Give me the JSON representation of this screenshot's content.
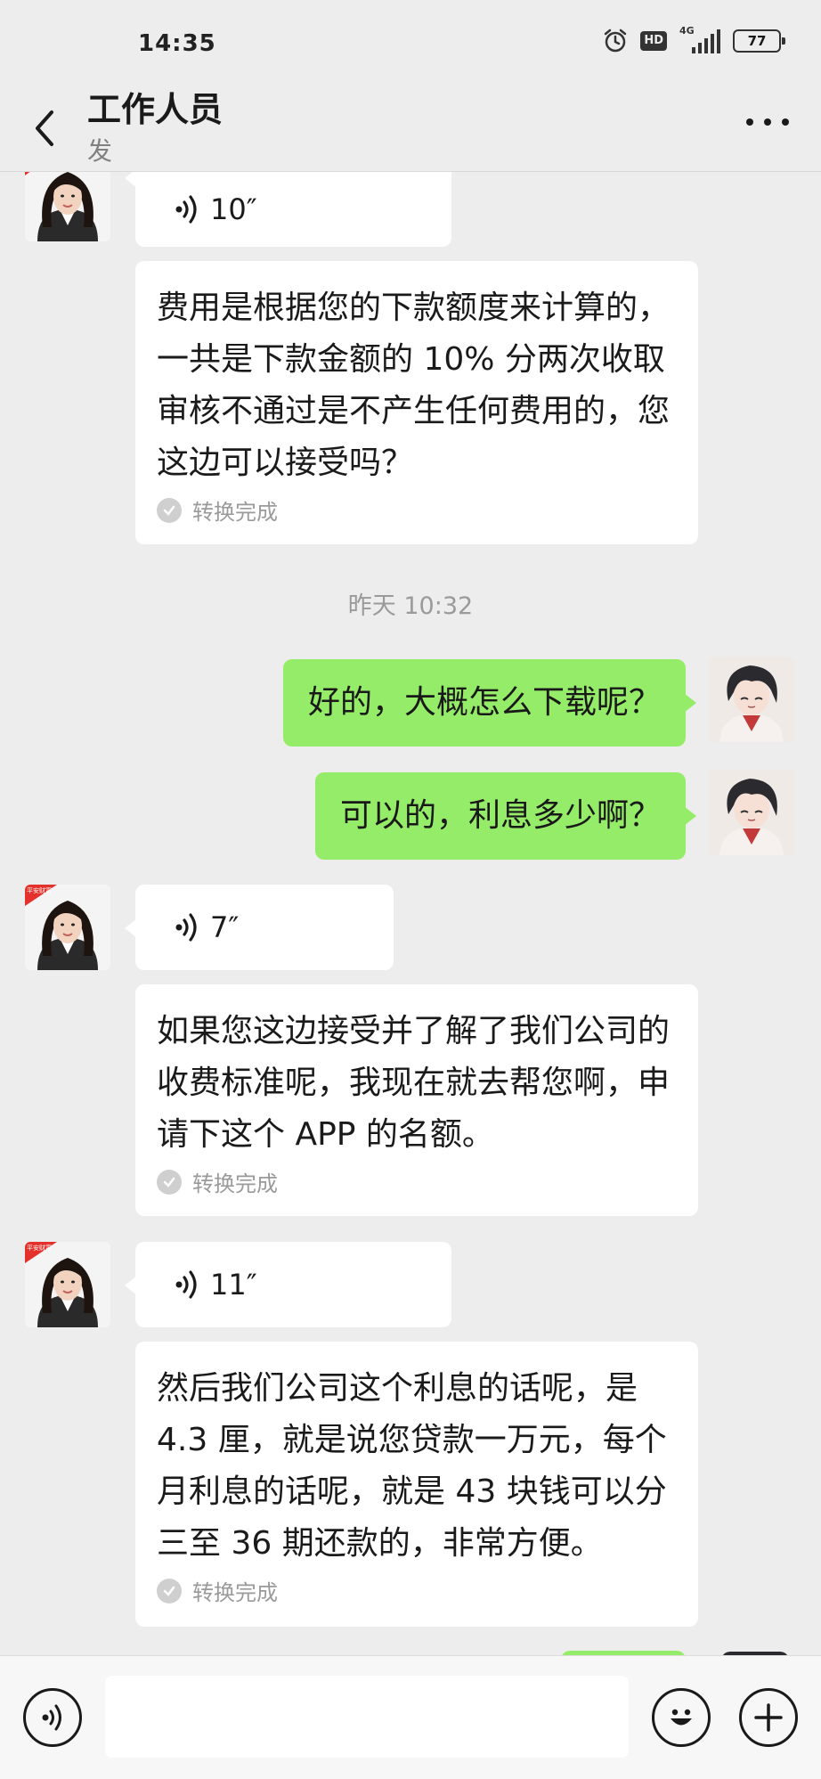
{
  "status": {
    "time": "14:35",
    "hd": "HD",
    "network": "4G",
    "battery": "77"
  },
  "nav": {
    "title": "工作人员",
    "subtitle": "发"
  },
  "messages": {
    "m1": {
      "duration": "10″",
      "text": "费用是根据您的下款额度来计算的，一共是下款金额的 10% 分两次收取审核不通过是不产生任何费用的，您这边可以接受吗？",
      "status": "转换完成"
    },
    "timestamp": "昨天 10:32",
    "out1": "好的，大概怎么下载呢？",
    "out2": "可以的，利息多少啊？",
    "m2": {
      "duration": "7″",
      "text": "如果您这边接受并了解了我们公司的收费标准呢，我现在就去帮您啊，申请下这个 APP 的名额。",
      "status": "转换完成"
    },
    "m3": {
      "duration": "11″",
      "text": "然后我们公司这个利息的话呢，是 4.3 厘，就是说您贷款一万元，每个月利息的话呢，就是 43 块钱可以分三至 36 期还款的，非常方便。",
      "status": "转换完成"
    }
  },
  "avatar_badge": "平安财富",
  "colors": {
    "outgoing_bubble": "#95ec69",
    "background": "#ededed",
    "incoming_bubble": "#ffffff",
    "badge_red": "#e4312b"
  },
  "icons": [
    "alarm-icon",
    "back-icon",
    "more-icon",
    "voice-wave-icon",
    "check-icon",
    "voice-input-icon",
    "emoji-icon",
    "plus-icon"
  ]
}
